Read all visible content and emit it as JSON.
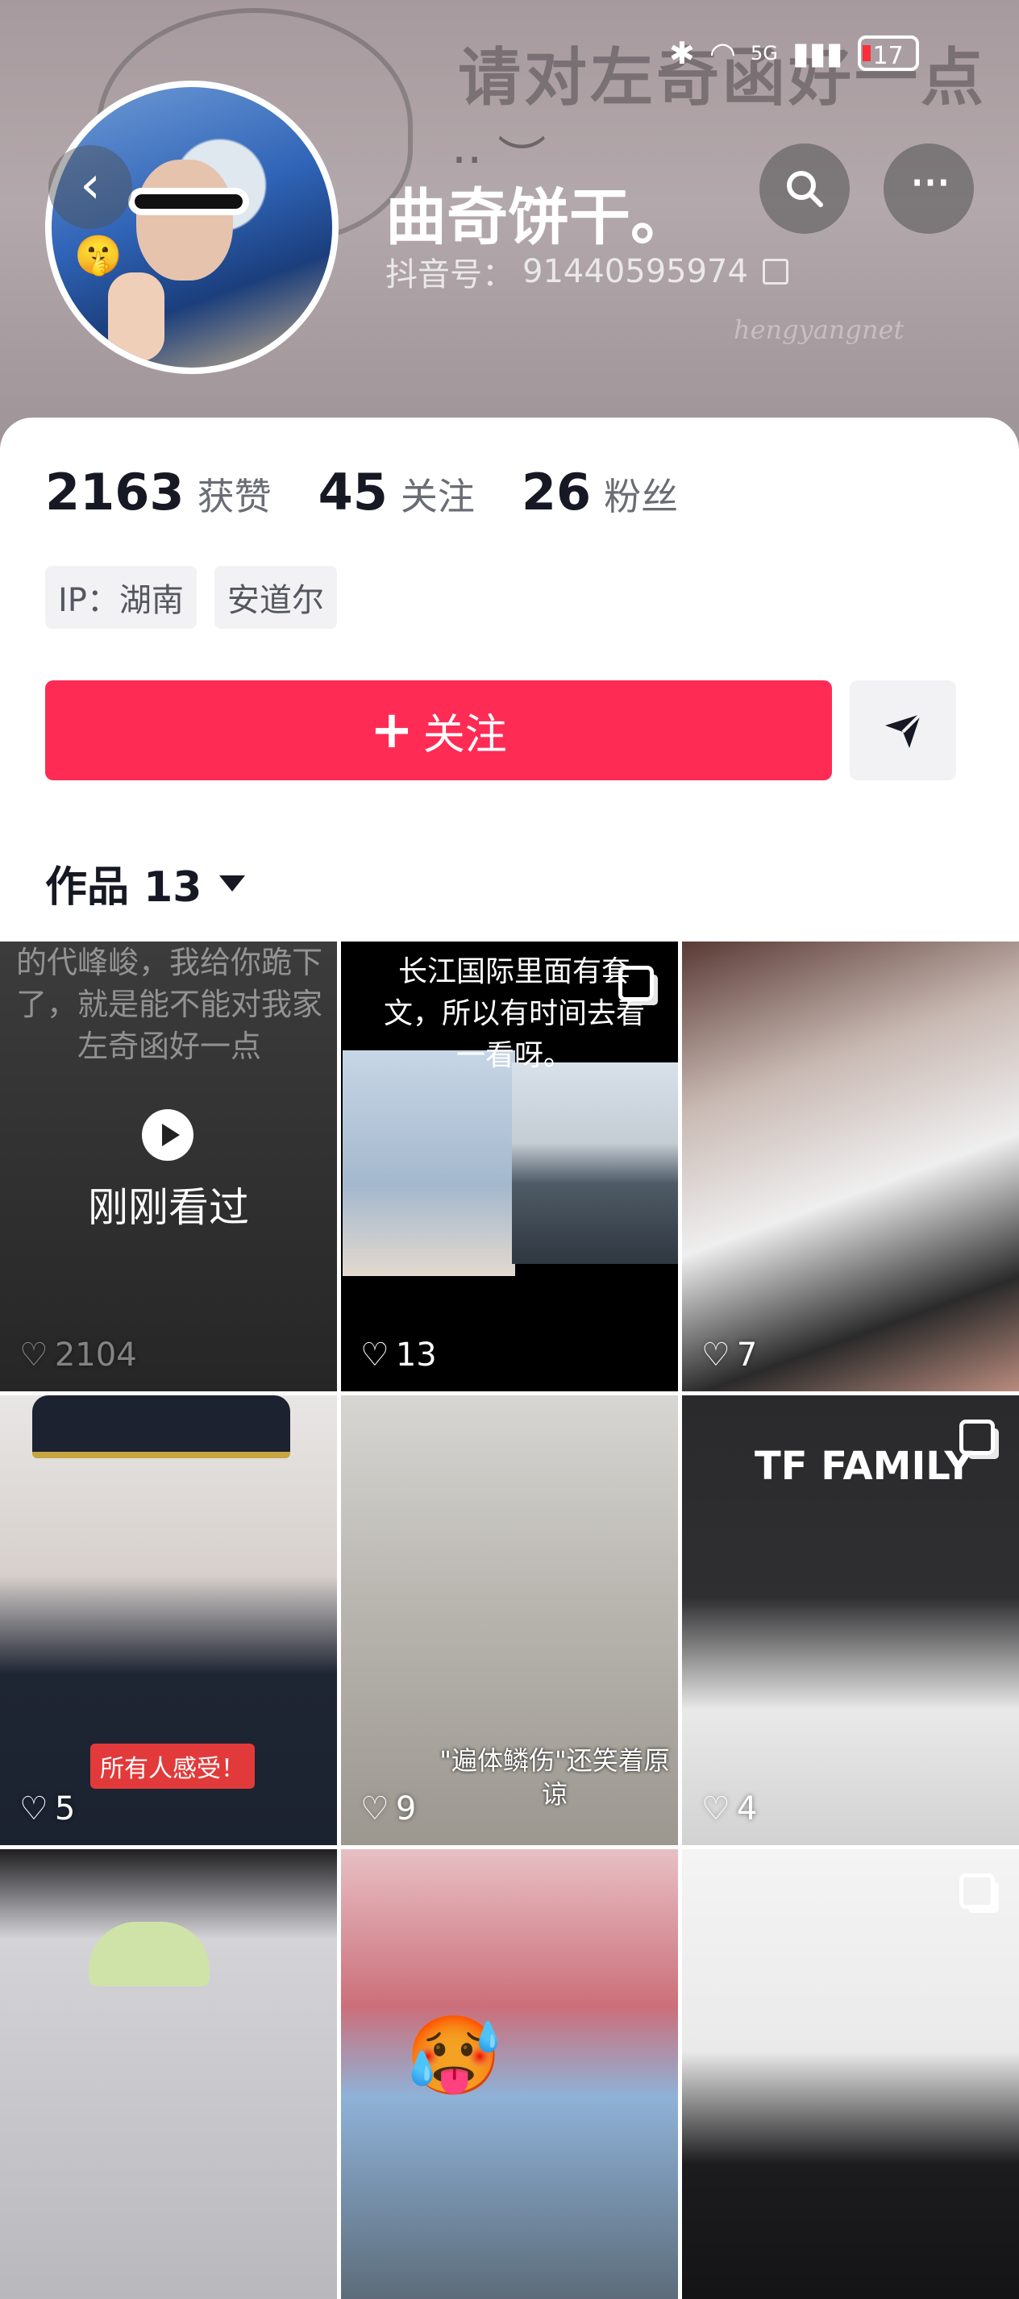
{
  "status_bar": {
    "time": "",
    "network": "5G",
    "battery": "17"
  },
  "cover": {
    "overlay_text": "请对左奇函好一点",
    "watermark": "hengyangnet"
  },
  "profile": {
    "name": "曲奇饼干。",
    "douyin_id_label": "抖音号：",
    "douyin_id": "91440595974"
  },
  "stats": [
    {
      "value": "2163",
      "label": "获赞"
    },
    {
      "value": "45",
      "label": "关注"
    },
    {
      "value": "26",
      "label": "粉丝"
    }
  ],
  "tags": [
    "IP：湖南",
    "安道尔"
  ],
  "actions": {
    "follow_label": "关注"
  },
  "works_tab": {
    "label": "作品 13"
  },
  "videos": [
    {
      "likes": "2104",
      "overlay_text": "的代峰峻，我给你跪下了，就是能不能对我家左奇函好一点",
      "seen_label": "刚刚看过"
    },
    {
      "likes": "13",
      "overlay_text": "长江国际里面有套文，所以有时间去看一看呀。"
    },
    {
      "likes": "7"
    },
    {
      "likes": "5",
      "banner_text": "所有人感受！"
    },
    {
      "likes": "9",
      "caption": "\"遍体鳞伤\"还笑着原谅"
    },
    {
      "likes": "4",
      "logo_text": "TF FAMILY"
    },
    {
      "likes": ""
    },
    {
      "likes": ""
    },
    {
      "likes": ""
    }
  ],
  "colors": {
    "accent": "#fe2c55",
    "text": "#161823",
    "secondary_text": "#6b6d75"
  }
}
